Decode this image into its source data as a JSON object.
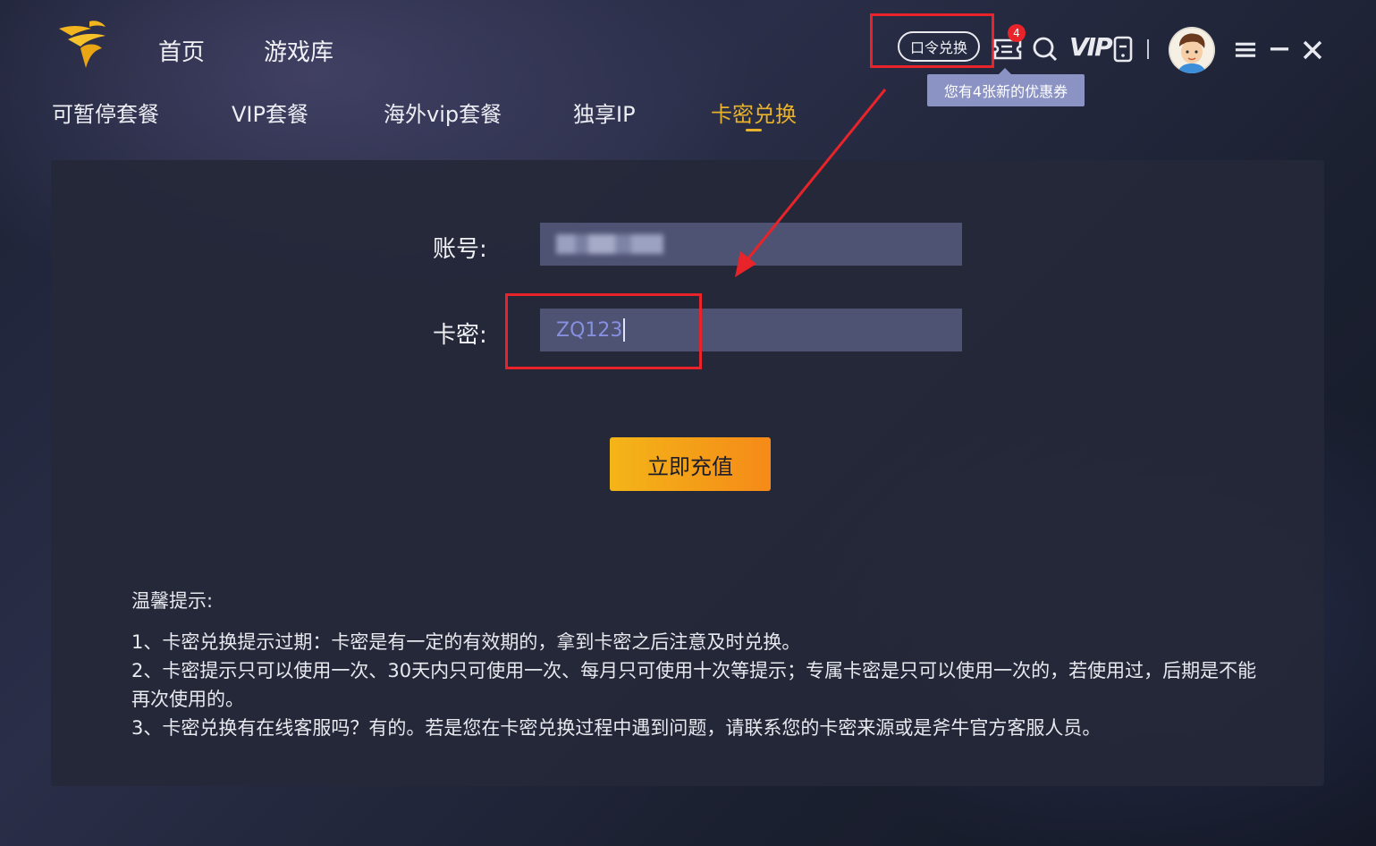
{
  "app": {
    "title": ""
  },
  "top_nav": {
    "home": "首页",
    "game_library": "游戏库"
  },
  "toolbar": {
    "redeem_code": "口令兑换",
    "message_badge": "4",
    "vip": "VIP",
    "coupon_tooltip": "您有4张新的优惠券"
  },
  "sub_nav": {
    "items": [
      "可暂停套餐",
      "VIP套餐",
      "海外vip套餐",
      "独享IP",
      "卡密兑换"
    ],
    "active_index": 4
  },
  "form": {
    "account_label": "账号:",
    "account_value": "",
    "card_label": "卡密:",
    "card_value": "ZQ123",
    "submit_label": "立即充值"
  },
  "tips": {
    "title": "温馨提示:",
    "lines": [
      "1、卡密兑换提示过期：卡密是有一定的有效期的，拿到卡密之后注意及时兑换。",
      "2、卡密提示只可以使用一次、30天内只可使用一次、每月只可使用十次等提示；专属卡密是只可以使用一次的，若使用过，后期是不能再次使用的。",
      "3、卡密兑换有在线客服吗？有的。若是您在卡密兑换过程中遇到问题，请联系您的卡密来源或是斧牛官方客服人员。"
    ]
  },
  "colors": {
    "accent": "#e8b22b",
    "highlight": "#e8242a",
    "input_bg": "#4e5273",
    "button_start": "#f4b518",
    "button_end": "#f58a18"
  },
  "icons": [
    "logo-icon",
    "coupon-icon",
    "search-icon",
    "vip-icon",
    "phone-icon",
    "avatar",
    "menu-icon",
    "minimize-icon",
    "close-icon"
  ]
}
